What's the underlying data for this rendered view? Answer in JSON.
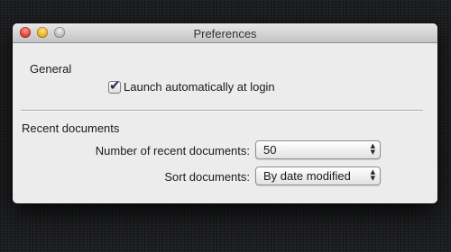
{
  "window": {
    "title": "Preferences",
    "buttons": {
      "close": "close-button",
      "minimize": "minimize-button",
      "zoom": "zoom-button"
    }
  },
  "general": {
    "heading": "General",
    "launch_checkbox": {
      "label": "Launch automatically at login",
      "checked": true
    }
  },
  "recent": {
    "heading": "Recent documents",
    "count_label": "Number of recent documents:",
    "count_value": "50",
    "sort_label": "Sort documents:",
    "sort_value": "By date modified"
  },
  "icons": {
    "checkmark": "✔",
    "arrow_up": "▲",
    "arrow_down": "▼"
  },
  "colors": {
    "close": "#e0443a",
    "minimize": "#e9b328",
    "zoom": "#b9b9b9",
    "background": "#1d1e20",
    "window": "#ececec"
  }
}
